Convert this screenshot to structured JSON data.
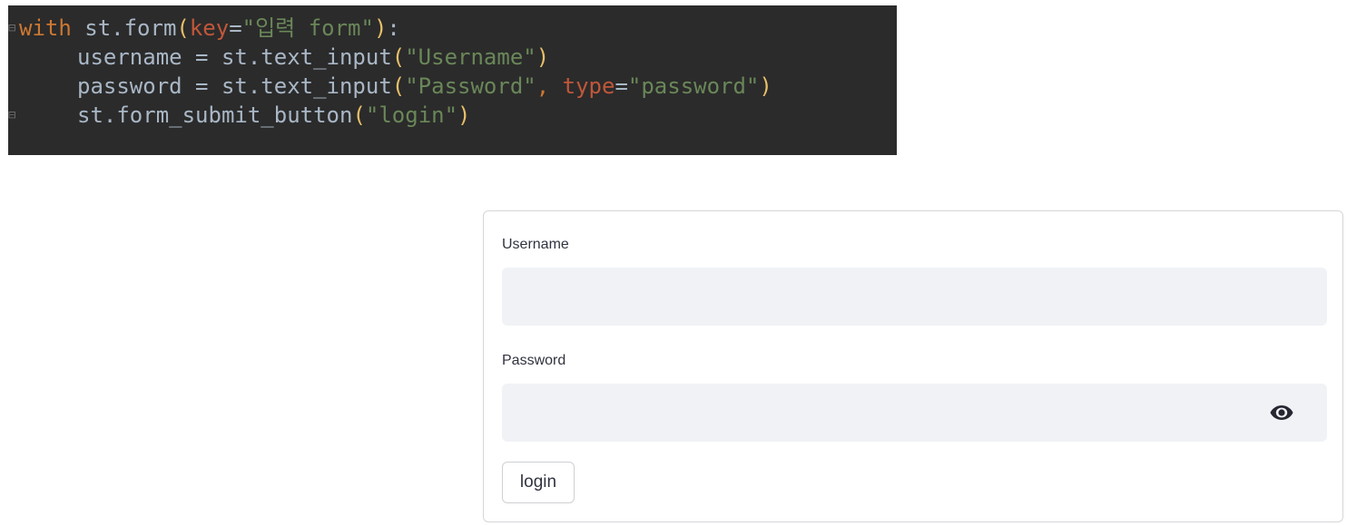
{
  "code": {
    "gutter_open": "⊟",
    "gutter_close": "⊟",
    "line1": {
      "kw_with": "with",
      "obj": " st.form",
      "open_paren": "(",
      "arg_key": "key",
      "eq": "=",
      "key_value": "\"입력 form\"",
      "close_paren": ")",
      "colon": ":"
    },
    "line2": {
      "lhs": "username = st.text_input",
      "open_paren": "(",
      "label_str": "\"Username\"",
      "close_paren": ")"
    },
    "line3": {
      "lhs": "password = st.text_input",
      "open_paren": "(",
      "label_str": "\"Password\"",
      "comma": ", ",
      "arg_type": "type",
      "eq": "=",
      "type_value": "\"password\"",
      "close_paren": ")"
    },
    "line4": {
      "lhs": "st.form_submit_button",
      "open_paren": "(",
      "label_str": "\"login\"",
      "close_paren": ")"
    }
  },
  "form": {
    "username_label": "Username",
    "username_value": "",
    "password_label": "Password",
    "password_value": "",
    "password_toggle_icon": "eye-icon",
    "submit_label": "login"
  },
  "colors": {
    "editor_bg": "#2b2b2b",
    "keyword": "#cc7832",
    "string": "#6a8759",
    "paren": "#e8bf6a",
    "input_bg": "#f0f2f6",
    "text": "#31333f"
  }
}
